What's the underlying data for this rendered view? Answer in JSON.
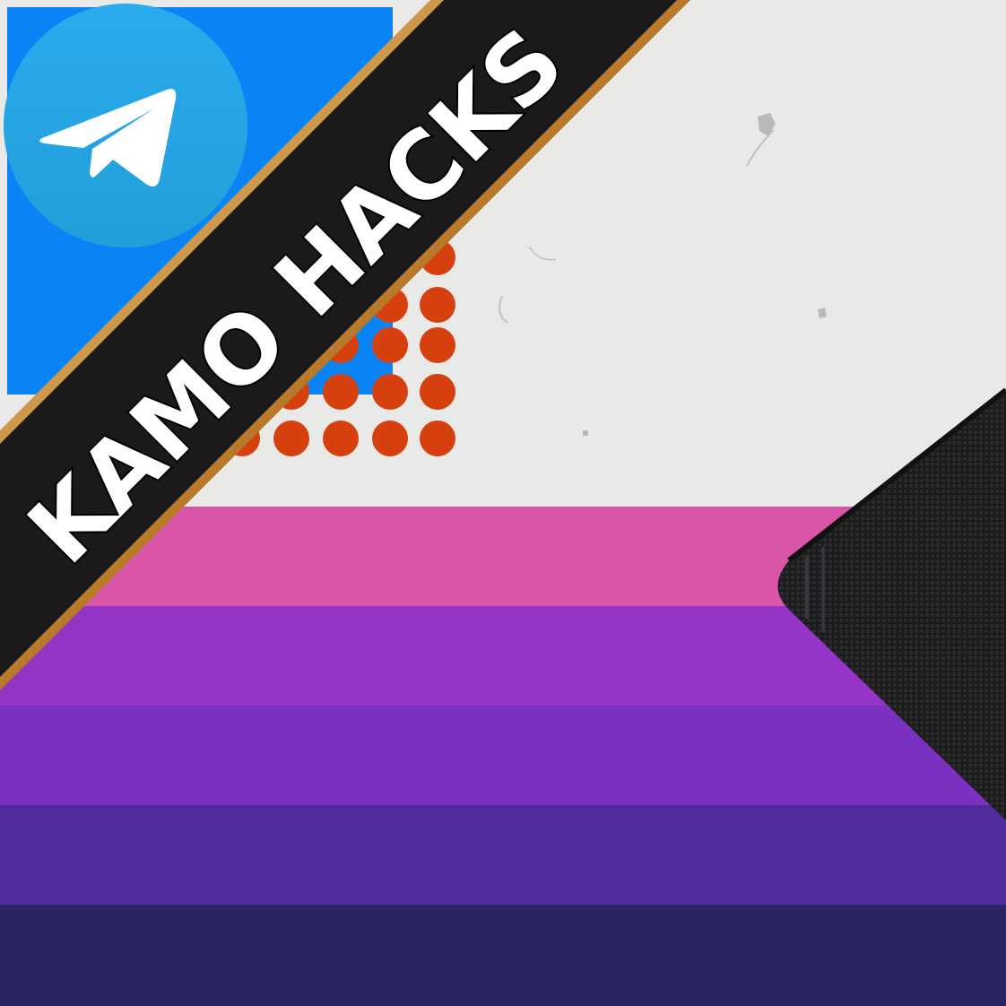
{
  "banner": {
    "text": "KAMO HACKS",
    "text_color": "#ffffff",
    "ribbon_color": "#1a1a1a",
    "border_color": "#d9a24a"
  },
  "telegram_logo": {
    "icon": "telegram-paper-plane-icon",
    "gradient_top": "#2aabee",
    "gradient_bottom": "#229ed9",
    "plane_color": "#ffffff"
  },
  "background": {
    "paper_color": "#e9e9e7",
    "blue_panel_color": "#0a84f5",
    "dot_color": "#d6400f",
    "stripes": [
      "#d955a8",
      "#9435c8",
      "#7a31c0",
      "#4f2d9e",
      "#2b2463"
    ]
  },
  "corner_graphic": {
    "icon": "dark-mesh-speaker-panel",
    "color": "#1b1b1d"
  }
}
